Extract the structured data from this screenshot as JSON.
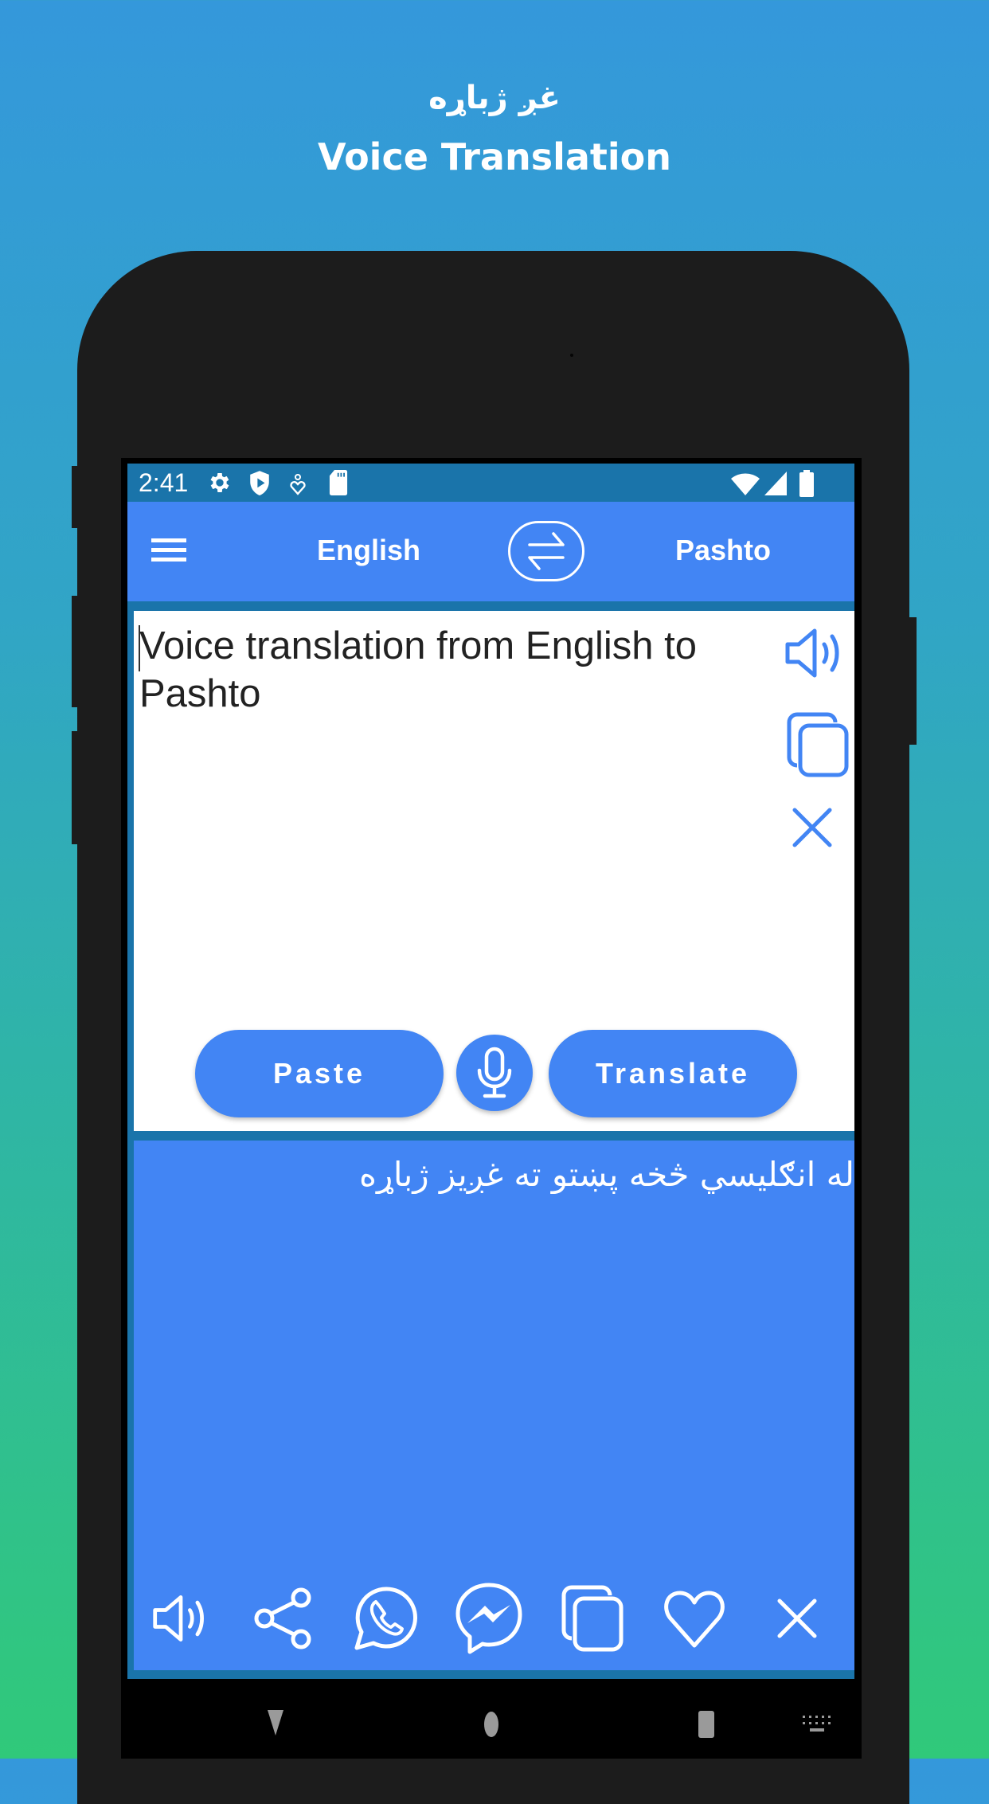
{
  "promo": {
    "title_pashto": "غږ ژباړه",
    "title_english": "Voice Translation"
  },
  "status_bar": {
    "time": "2:41",
    "left_icons": [
      "settings-icon",
      "shield-play-icon",
      "accessibility-icon",
      "sd-card-icon"
    ],
    "right_icons": [
      "wifi-icon",
      "signal-icon",
      "battery-icon"
    ]
  },
  "app_bar": {
    "menu_icon": "menu-icon",
    "source_language": "English",
    "swap_icon": "swap-arrows-icon",
    "target_language": "Pashto"
  },
  "input": {
    "text": "Voice translation from English to Pashto",
    "side_actions": [
      {
        "name": "speak",
        "icon": "speaker-icon"
      },
      {
        "name": "copy",
        "icon": "copy-icon"
      },
      {
        "name": "clear",
        "icon": "close-icon"
      }
    ],
    "paste_label": "Paste",
    "translate_label": "Translate",
    "mic_icon": "microphone-icon"
  },
  "output": {
    "text": "له انګليسي څخه پښتو ته غږيز ژباړه",
    "actions": [
      {
        "name": "speak",
        "icon": "speaker-icon"
      },
      {
        "name": "share",
        "icon": "share-icon"
      },
      {
        "name": "whatsapp",
        "icon": "whatsapp-icon"
      },
      {
        "name": "messenger",
        "icon": "messenger-icon"
      },
      {
        "name": "copy",
        "icon": "copy-icon"
      },
      {
        "name": "favorite",
        "icon": "heart-icon"
      },
      {
        "name": "clear",
        "icon": "close-icon"
      }
    ]
  },
  "nav_bar": {
    "buttons": [
      "back-icon",
      "home-icon",
      "recents-icon",
      "keyboard-icon"
    ]
  },
  "colors": {
    "primary": "#4285f4",
    "status_bar": "#1a74aa",
    "bg_top": "#3498db",
    "bg_bottom": "#30c97a",
    "phone_body": "#1c1c1c"
  }
}
